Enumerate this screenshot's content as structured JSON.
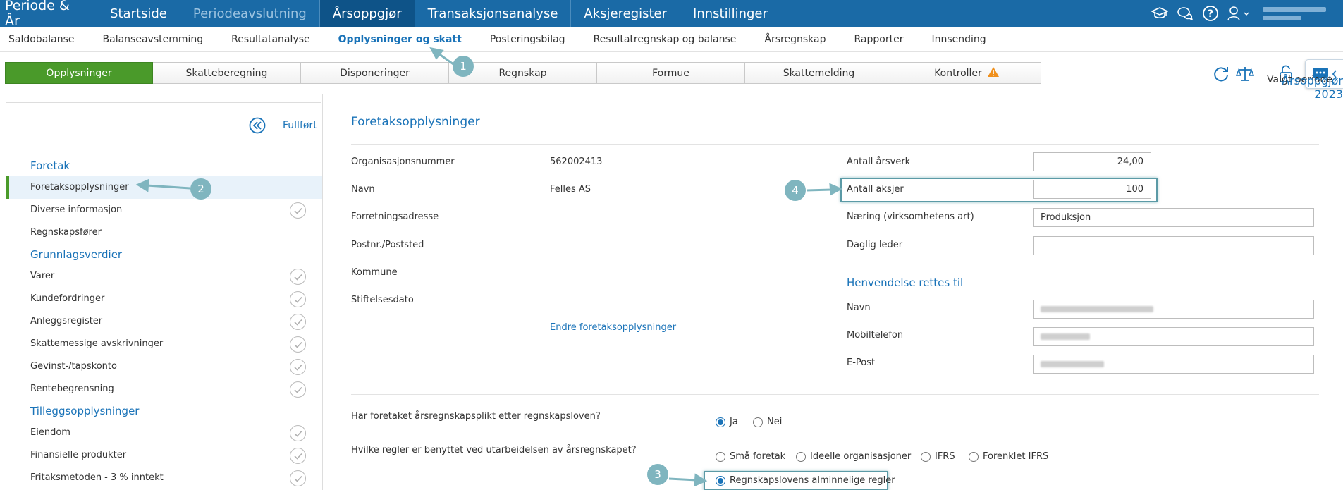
{
  "topbar": {
    "brand": "Periode & År",
    "items": [
      {
        "label": "Startside"
      },
      {
        "label": "Periodeavslutning"
      },
      {
        "label": "Årsoppgjør"
      },
      {
        "label": "Transaksjonsanalyse"
      },
      {
        "label": "Aksjeregister"
      },
      {
        "label": "Innstillinger"
      }
    ],
    "icons": [
      "graduation-cap-icon",
      "chat-icon",
      "help-icon",
      "user-icon"
    ]
  },
  "subnav": {
    "items": [
      {
        "label": "Saldobalanse"
      },
      {
        "label": "Balanseavstemming"
      },
      {
        "label": "Resultatanalyse"
      },
      {
        "label": "Opplysninger og skatt"
      },
      {
        "label": "Posteringsbilag"
      },
      {
        "label": "Resultatregnskap og balanse"
      },
      {
        "label": "Årsregnskap"
      },
      {
        "label": "Rapporter"
      },
      {
        "label": "Innsending"
      }
    ]
  },
  "tabs": [
    {
      "label": "Opplysninger"
    },
    {
      "label": "Skatteberegning"
    },
    {
      "label": "Disponeringer"
    },
    {
      "label": "Regnskap"
    },
    {
      "label": "Formue"
    },
    {
      "label": "Skattemelding"
    },
    {
      "label": "Kontroller"
    }
  ],
  "period": {
    "label": "Valgt periode",
    "value": "Årsoppgjør 2023"
  },
  "left": {
    "fullfort": "Fullført",
    "groups": [
      {
        "title": "Foretak",
        "items": [
          {
            "label": "Foretaksopplysninger"
          },
          {
            "label": "Diverse informasjon"
          },
          {
            "label": "Regnskapsfører"
          }
        ]
      },
      {
        "title": "Grunnlagsverdier",
        "items": [
          {
            "label": "Varer"
          },
          {
            "label": "Kundefordringer"
          },
          {
            "label": "Anleggsregister"
          },
          {
            "label": "Skattemessige avskrivninger"
          },
          {
            "label": "Gevinst-/tapskonto"
          },
          {
            "label": "Rentebegrensning"
          }
        ]
      },
      {
        "title": "Tilleggsopplysninger",
        "items": [
          {
            "label": "Eiendom"
          },
          {
            "label": "Finansielle produkter"
          },
          {
            "label": "Fritaksmetoden - 3 % inntekt"
          }
        ]
      }
    ]
  },
  "main": {
    "title": "Foretaksopplysninger",
    "org_label": "Organisasjonsnummer",
    "org_value": "562002413",
    "navn_label": "Navn",
    "navn_value": "Felles AS",
    "adresse_label": "Forretningsadresse",
    "postnr_label": "Postnr./Poststed",
    "kommune_label": "Kommune",
    "stiftelse_label": "Stiftelsesdato",
    "edit_link": "Endre foretaksopplysninger",
    "arsverk_label": "Antall årsverk",
    "arsverk_value": "24,00",
    "aksjer_label": "Antall aksjer",
    "aksjer_value": "100",
    "naering_label": "Næring (virksomhetens art)",
    "naering_value": "Produksjon",
    "leder_label": "Daglig leder",
    "leder_value": "",
    "henvendelse_title": "Henvendelse rettes til",
    "h_navn_label": "Navn",
    "h_mobil_label": "Mobiltelefon",
    "h_epost_label": "E-Post",
    "q1": "Har foretaket årsregnskapsplikt etter regnskapsloven?",
    "q1_options": [
      {
        "label": "Ja"
      },
      {
        "label": "Nei"
      }
    ],
    "q1_selected": "Ja",
    "q2": "Hvilke regler er benyttet ved utarbeidelsen av årsregnskapet?",
    "q2_options": [
      {
        "label": "Små foretak"
      },
      {
        "label": "Ideelle organisasjoner"
      },
      {
        "label": "IFRS"
      },
      {
        "label": "Forenklet IFRS"
      },
      {
        "label": "Regnskapslovens alminnelige regler"
      }
    ],
    "q2_selected": "Regnskapslovens alminnelige regler"
  },
  "annotations": [
    "1",
    "2",
    "3",
    "4"
  ],
  "colors": {
    "brand_blue": "#1a6aa6",
    "active_green": "#4a9a2a",
    "link_blue": "#1a73b8",
    "annotation": "#7fb5bf",
    "warning": "#f0901c"
  }
}
